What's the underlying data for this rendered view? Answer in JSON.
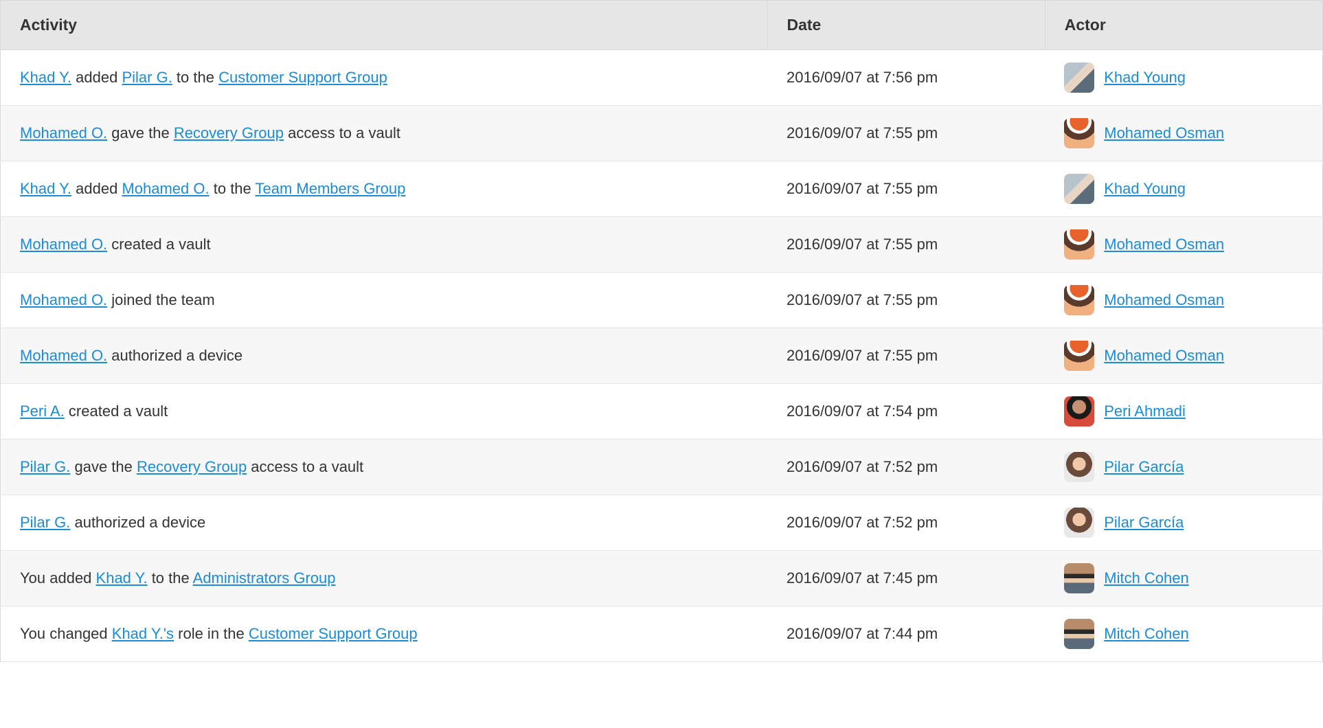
{
  "table": {
    "headers": {
      "activity": "Activity",
      "date": "Date",
      "actor": "Actor"
    },
    "rows": [
      {
        "activity_parts": [
          {
            "type": "link",
            "text": "Khad Y."
          },
          {
            "type": "text",
            "text": " added "
          },
          {
            "type": "link",
            "text": "Pilar G."
          },
          {
            "type": "text",
            "text": " to the "
          },
          {
            "type": "link",
            "text": "Customer Support Group"
          }
        ],
        "date": "2016/09/07 at 7:56 pm",
        "actor_name": "Khad Young",
        "avatar": "khad"
      },
      {
        "activity_parts": [
          {
            "type": "link",
            "text": "Mohamed O."
          },
          {
            "type": "text",
            "text": " gave the "
          },
          {
            "type": "link",
            "text": "Recovery Group"
          },
          {
            "type": "text",
            "text": " access to a vault"
          }
        ],
        "date": "2016/09/07 at 7:55 pm",
        "actor_name": "Mohamed Osman",
        "avatar": "mohamed"
      },
      {
        "activity_parts": [
          {
            "type": "link",
            "text": "Khad Y."
          },
          {
            "type": "text",
            "text": " added "
          },
          {
            "type": "link",
            "text": "Mohamed O."
          },
          {
            "type": "text",
            "text": " to the "
          },
          {
            "type": "link",
            "text": "Team Members Group"
          }
        ],
        "date": "2016/09/07 at 7:55 pm",
        "actor_name": "Khad Young",
        "avatar": "khad"
      },
      {
        "activity_parts": [
          {
            "type": "link",
            "text": "Mohamed O."
          },
          {
            "type": "text",
            "text": " created a vault"
          }
        ],
        "date": "2016/09/07 at 7:55 pm",
        "actor_name": "Mohamed Osman",
        "avatar": "mohamed"
      },
      {
        "activity_parts": [
          {
            "type": "link",
            "text": "Mohamed O."
          },
          {
            "type": "text",
            "text": " joined the team"
          }
        ],
        "date": "2016/09/07 at 7:55 pm",
        "actor_name": "Mohamed Osman",
        "avatar": "mohamed"
      },
      {
        "activity_parts": [
          {
            "type": "link",
            "text": "Mohamed O."
          },
          {
            "type": "text",
            "text": " authorized a device"
          }
        ],
        "date": "2016/09/07 at 7:55 pm",
        "actor_name": "Mohamed Osman",
        "avatar": "mohamed"
      },
      {
        "activity_parts": [
          {
            "type": "link",
            "text": "Peri A."
          },
          {
            "type": "text",
            "text": " created a vault"
          }
        ],
        "date": "2016/09/07 at 7:54 pm",
        "actor_name": "Peri Ahmadi",
        "avatar": "peri"
      },
      {
        "activity_parts": [
          {
            "type": "link",
            "text": "Pilar G."
          },
          {
            "type": "text",
            "text": " gave the "
          },
          {
            "type": "link",
            "text": "Recovery Group"
          },
          {
            "type": "text",
            "text": " access to a vault"
          }
        ],
        "date": "2016/09/07 at 7:52 pm",
        "actor_name": "Pilar García",
        "avatar": "pilar"
      },
      {
        "activity_parts": [
          {
            "type": "link",
            "text": "Pilar G."
          },
          {
            "type": "text",
            "text": " authorized a device"
          }
        ],
        "date": "2016/09/07 at 7:52 pm",
        "actor_name": "Pilar García",
        "avatar": "pilar"
      },
      {
        "activity_parts": [
          {
            "type": "text",
            "text": "You added "
          },
          {
            "type": "link",
            "text": "Khad Y."
          },
          {
            "type": "text",
            "text": " to the "
          },
          {
            "type": "link",
            "text": "Administrators Group"
          }
        ],
        "date": "2016/09/07 at 7:45 pm",
        "actor_name": "Mitch Cohen",
        "avatar": "mitch"
      },
      {
        "activity_parts": [
          {
            "type": "text",
            "text": "You changed "
          },
          {
            "type": "link",
            "text": "Khad Y.'s"
          },
          {
            "type": "text",
            "text": " role in the "
          },
          {
            "type": "link",
            "text": "Customer Support Group"
          }
        ],
        "date": "2016/09/07 at 7:44 pm",
        "actor_name": "Mitch Cohen",
        "avatar": "mitch"
      }
    ]
  }
}
